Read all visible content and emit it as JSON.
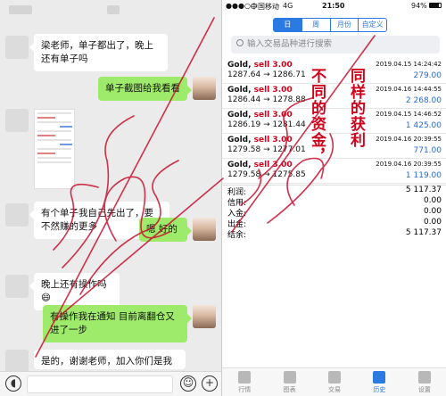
{
  "chat": {
    "messages": [
      {
        "side": "left",
        "text": "梁老师，单子都出了，晚上还有单子吗"
      },
      {
        "side": "right",
        "text": "单子截图给我看看"
      },
      {
        "side": "left",
        "text": "有个单子我自己先出了，要不然赚的更多"
      },
      {
        "side": "right",
        "text": "嗯 好的"
      },
      {
        "side": "left",
        "text": "晚上还有操作吗😄"
      },
      {
        "side": "right",
        "text": "有操作我在通知 目前离翻仓又进了一步"
      },
      {
        "side": "left",
        "text": "是的，谢谢老师，加入你们是我做"
      }
    ],
    "input_icons": {
      "voice": "voice-icon",
      "emoji": "emoji-icon",
      "plus": "plus-icon"
    }
  },
  "phone": {
    "status": {
      "carrier": "中国移动",
      "network": "4G",
      "time": "21:50",
      "battery": "94%"
    },
    "tabs": [
      {
        "label": "日",
        "active": true
      },
      {
        "label": "周",
        "active": false
      },
      {
        "label": "月份",
        "active": false
      },
      {
        "label": "自定义",
        "active": false
      }
    ],
    "search_placeholder": "输入交易品种进行搜索",
    "trades": [
      {
        "symbol": "Gold",
        "side": "sell 3.00",
        "prices": "1287.64 → 1286.71",
        "date": "2019.04.15 14:24:42",
        "profit": "279.00"
      },
      {
        "symbol": "Gold",
        "side": "sell 3.00",
        "prices": "1286.44 → 1278.88",
        "date": "2019.04.16 14:44:55",
        "profit": "2 268.00"
      },
      {
        "symbol": "Gold",
        "side": "sell 3.00",
        "prices": "1286.19 → 1281.44",
        "date": "2019.04.15 14:46:52",
        "profit": "1 425.00"
      },
      {
        "symbol": "Gold",
        "side": "sell 3.00",
        "prices": "1279.58 → 1277.01",
        "date": "2019.04.16 20:39:55",
        "profit": "771.00"
      },
      {
        "symbol": "Gold",
        "side": "sell 3.00",
        "prices": "1279.58 → 1275.85",
        "date": "2019.04.16 20:39:55",
        "profit": "1 119.00"
      }
    ],
    "summary": [
      {
        "label": "利润:",
        "value": "5 117.37"
      },
      {
        "label": "信用:",
        "value": "0.00"
      },
      {
        "label": "入金:",
        "value": "0.00"
      },
      {
        "label": "出金:",
        "value": "0.00"
      },
      {
        "label": "结余:",
        "value": "5 117.37"
      }
    ],
    "tabbar": [
      {
        "label": "行情",
        "active": false
      },
      {
        "label": "图表",
        "active": false
      },
      {
        "label": "交易",
        "active": false
      },
      {
        "label": "历史",
        "active": true
      },
      {
        "label": "设置",
        "active": false
      }
    ]
  },
  "overlay": {
    "caption_col1": "同样的获利",
    "caption_col2": "不同的资金，",
    "accent": "#d0021b"
  }
}
